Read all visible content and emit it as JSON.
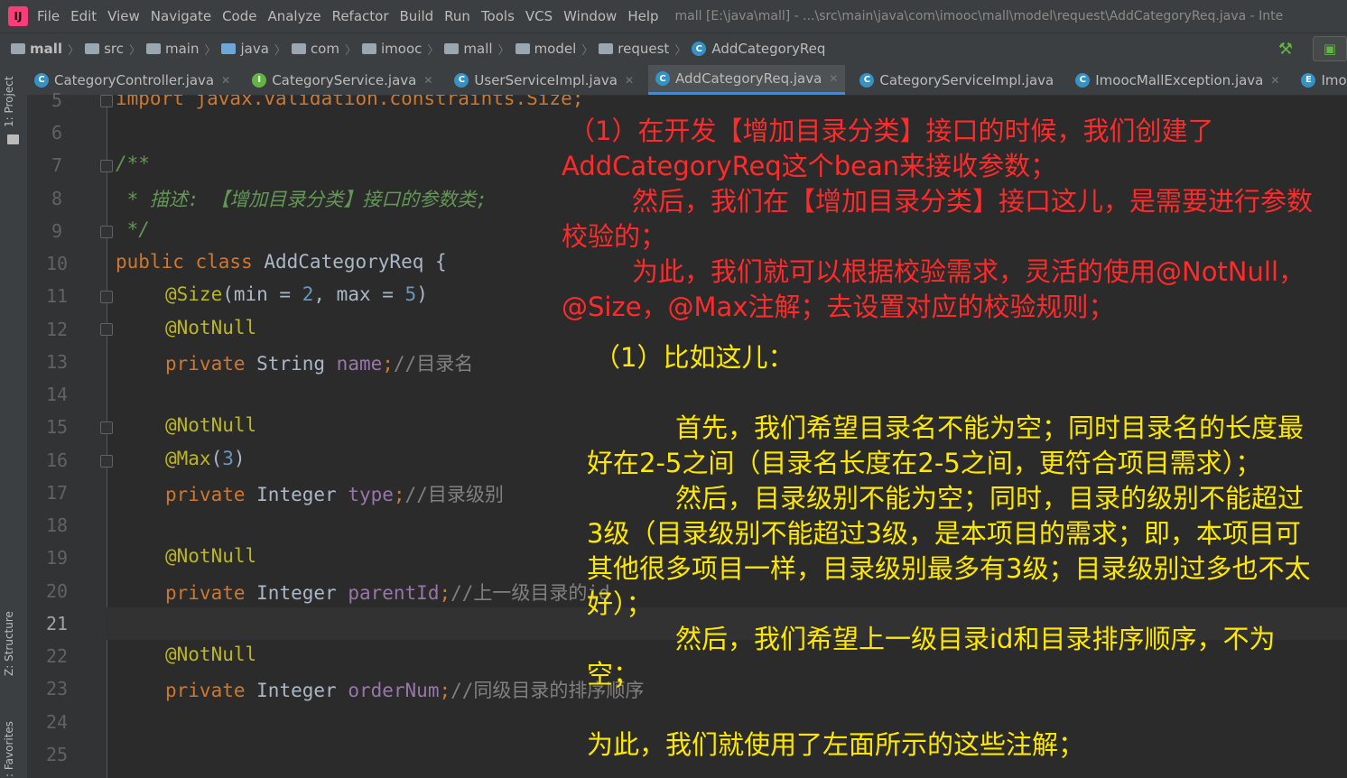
{
  "menu": {
    "items": [
      "File",
      "Edit",
      "View",
      "Navigate",
      "Code",
      "Analyze",
      "Refactor",
      "Build",
      "Run",
      "Tools",
      "VCS",
      "Window",
      "Help"
    ],
    "window_title": "mall [E:\\java\\mall] - ...\\src\\main\\java\\com\\imooc\\mall\\model\\request\\AddCategoryReq.java - Inte"
  },
  "breadcrumb": [
    "mall",
    "src",
    "main",
    "java",
    "com",
    "imooc",
    "mall",
    "model",
    "request",
    "AddCategoryReq"
  ],
  "tabs": [
    {
      "label": "CategoryController.java",
      "icon": "C"
    },
    {
      "label": "CategoryService.java",
      "icon": "I"
    },
    {
      "label": "UserServiceImpl.java",
      "icon": "C"
    },
    {
      "label": "AddCategoryReq.java",
      "icon": "C",
      "active": true
    },
    {
      "label": "CategoryServiceImpl.java",
      "icon": "C"
    },
    {
      "label": "ImoocMallException.java",
      "icon": "C"
    },
    {
      "label": "ImoocM",
      "icon": "E"
    }
  ],
  "side": {
    "project": "1: Project",
    "structure": "Z: Structure",
    "favorites": ": Favorites"
  },
  "line_numbers": [
    "5",
    "6",
    "7",
    "8",
    "9",
    "10",
    "11",
    "12",
    "13",
    "14",
    "15",
    "16",
    "17",
    "18",
    "19",
    "20",
    "21",
    "22",
    "23",
    "24",
    "25"
  ],
  "code": {
    "l5": "import javax.validation.constraints.Size;",
    "l7": "/**",
    "l8": " * 描述: 【增加目录分类】接口的参数类;",
    "l9": " */",
    "l10_kw": "public class",
    "l10_rest": " AddCategoryReq {",
    "l11_an": "@Size",
    "l11_a": "(min = ",
    "l11_n1": "2",
    "l11_b": ", max = ",
    "l11_n2": "5",
    "l11_c": ")",
    "l12": "@NotNull",
    "l13_kw": "private",
    "l13_type": " String ",
    "l13_fd": "name",
    "l13_semi": ";",
    "l13_cm": "//目录名",
    "l15": "@NotNull",
    "l16_an": "@Max",
    "l16_a": "(",
    "l16_n": "3",
    "l16_b": ")",
    "l17_kw": "private",
    "l17_type": " Integer ",
    "l17_fd": "type",
    "l17_semi": ";",
    "l17_cm": "//目录级别",
    "l19": "@NotNull",
    "l20_kw": "private",
    "l20_type": " Integer ",
    "l20_fd": "parentId",
    "l20_semi": ";",
    "l20_cm": "//上一级目录的id",
    "l22": "@NotNull",
    "l23_kw": "private",
    "l23_type": " Integer ",
    "l23_fd": "orderNum",
    "l23_semi": ";",
    "l23_cm": "//同级目录的排序顺序"
  },
  "notes": {
    "red1": "（1）在开发【增加目录分类】接口的时候，我们创建了",
    "red2": "AddCategoryReq这个bean来接收参数；",
    "red3": "然后，我们在【增加目录分类】接口这儿，是需要进行参数",
    "red4": "校验的；",
    "red5": "为此，我们就可以根据校验需求，灵活的使用@NotNull，",
    "red6": "@Size，@Max注解；去设置对应的校验规则；",
    "y1": "（1）比如这儿：",
    "y2": "首先，我们希望目录名不能为空；同时目录名的长度最",
    "y3": "好在2-5之间（目录名长度在2-5之间，更符合项目需求）；",
    "y4": "然后，目录级别不能为空；同时，目录的级别不能超过",
    "y5": "3级（目录级别不能超过3级，是本项目的需求；即，本项目可",
    "y6": "其他很多项目一样，目录级别最多有3级；目录级别过多也不太",
    "y7": "好）；",
    "y8": "然后，我们希望上一级目录id和目录排序顺序，不为",
    "y9": "空；",
    "y10": "为此，我们就使用了左面所示的这些注解；"
  }
}
